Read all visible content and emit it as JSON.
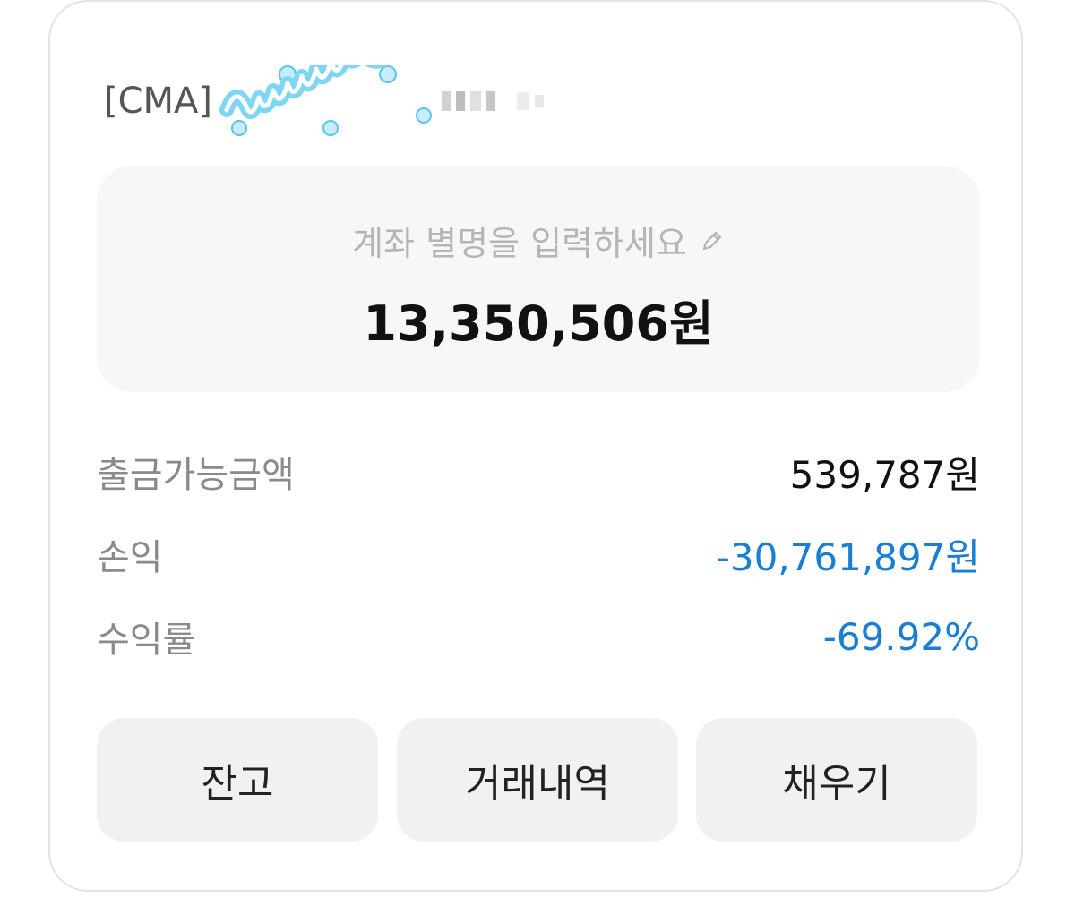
{
  "account": {
    "type_label": "[CMA]"
  },
  "balance_box": {
    "nickname_placeholder": "계좌 별명을 입력하세요",
    "total_balance": "13,350,506원"
  },
  "details": [
    {
      "label": "출금가능금액",
      "value": "539,787원",
      "color": "#111111"
    },
    {
      "label": "손익",
      "value": "-30,761,897원",
      "color": "#1a7fd4"
    },
    {
      "label": "수익률",
      "value": "-69.92%",
      "color": "#1a7fd4"
    }
  ],
  "buttons": {
    "balance": "잔고",
    "history": "거래내역",
    "deposit": "채우기"
  },
  "icons": {
    "edit": "pencil-icon"
  },
  "colors": {
    "negative": "#1a7fd4",
    "label": "#8a8a8a",
    "box_bg": "#f7f7f7",
    "button_bg": "#f1f1f1"
  }
}
